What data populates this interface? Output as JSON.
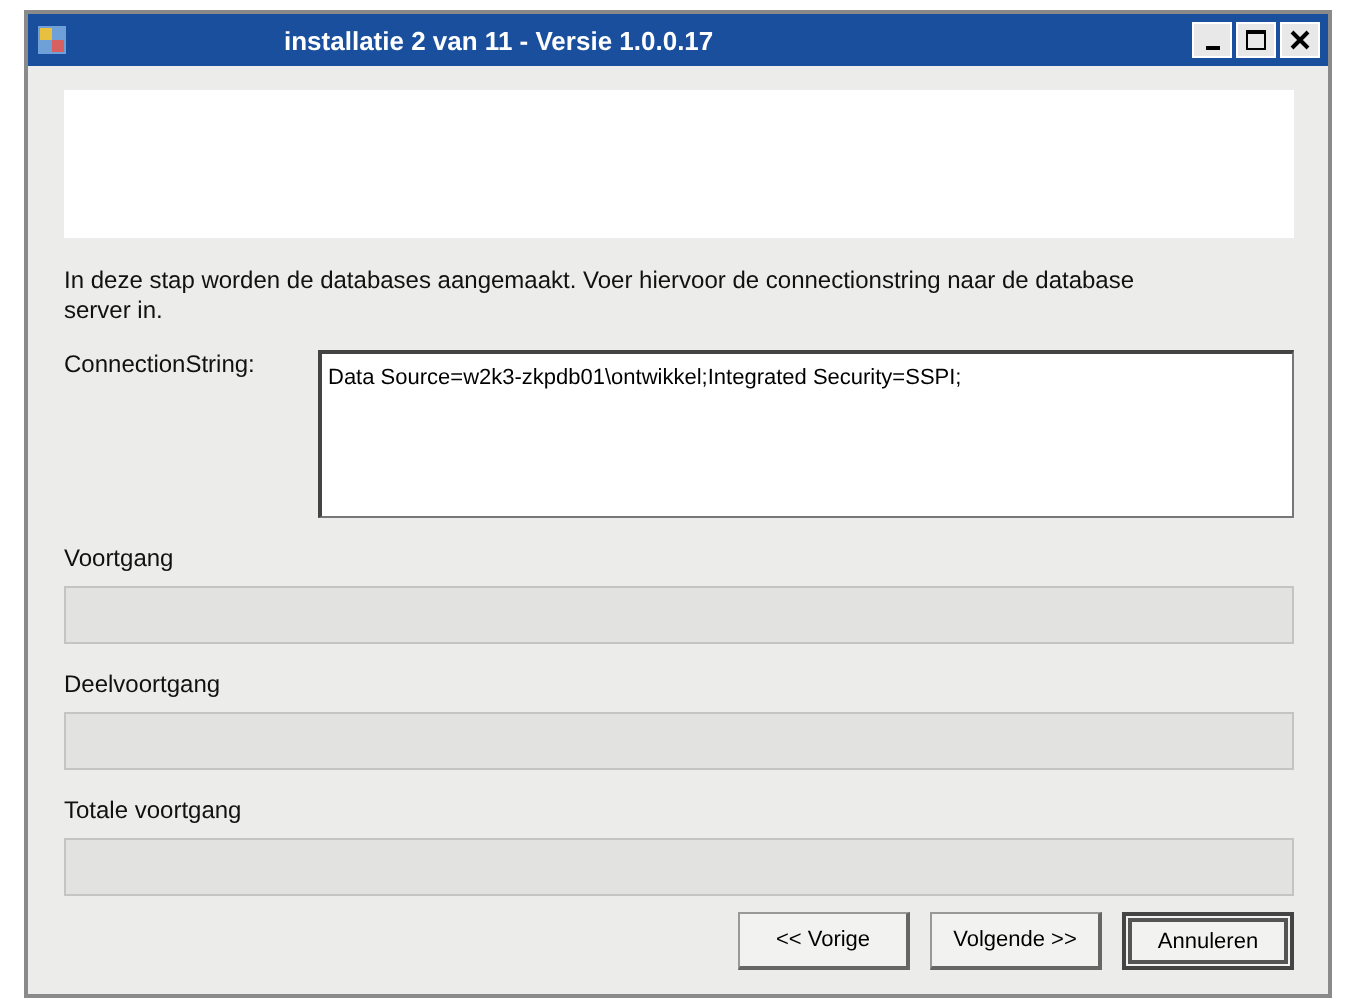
{
  "window": {
    "title": "installatie 2 van 11 - Versie 1.0.0.17"
  },
  "intro": "In deze stap worden de databases aangemaakt. Voer hiervoor de connectionstring naar de database server in.",
  "connection": {
    "label": "ConnectionString:",
    "value": "Data Source=w2k3-zkpdb01\\ontwikkel;Integrated Security=SSPI;"
  },
  "progress": [
    {
      "label": "Voortgang",
      "level": 0
    },
    {
      "label": "Deelvoortgang",
      "level": 0
    },
    {
      "label": "Totale voortgang",
      "level": 0
    }
  ],
  "buttons": [
    {
      "label": "<< Vorige",
      "default": false
    },
    {
      "label": "Volgende >>",
      "default": false
    },
    {
      "label": "Annuleren",
      "default": true
    }
  ]
}
